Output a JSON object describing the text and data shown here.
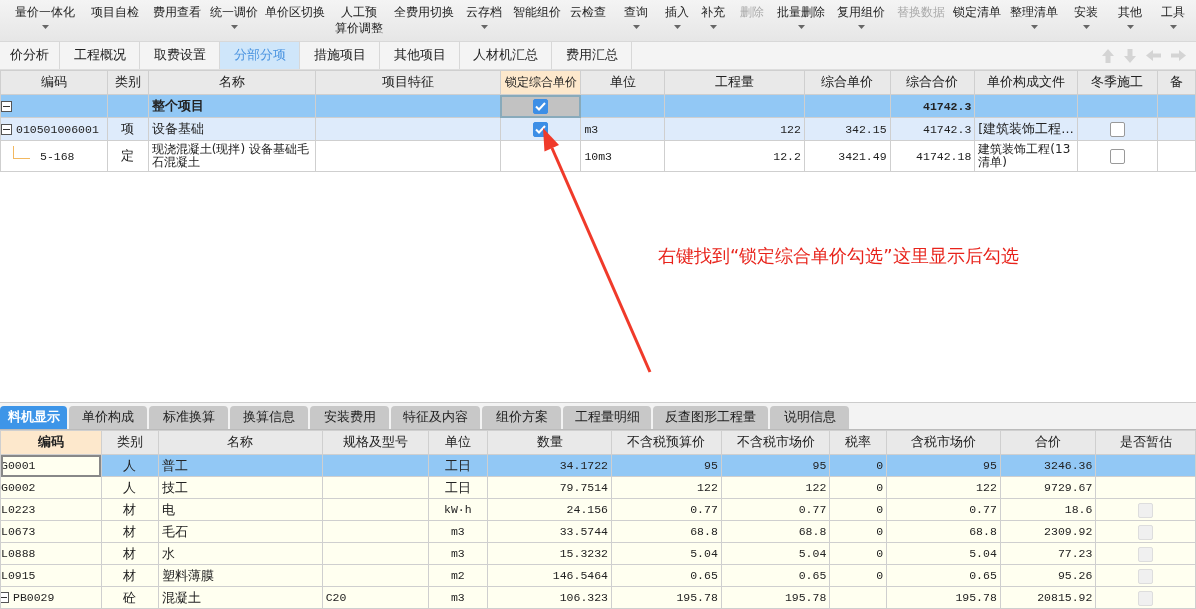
{
  "toolbar": [
    {
      "label": "量价一体化",
      "dropdown": true,
      "disabled": false
    },
    {
      "label": "项目自检",
      "dropdown": false,
      "disabled": false
    },
    {
      "label": "费用查看",
      "dropdown": false,
      "disabled": false
    },
    {
      "label": "统一调价",
      "dropdown": true,
      "disabled": false
    },
    {
      "label": "单价区切换",
      "dropdown": false,
      "disabled": false
    },
    {
      "label": "人工预",
      "label_2": "算价调整",
      "dropdown": false,
      "disabled": false
    },
    {
      "label": "全费用切换",
      "dropdown": false,
      "disabled": false
    },
    {
      "label": "云存档",
      "dropdown": true,
      "disabled": false
    },
    {
      "label": "智能组价",
      "dropdown": false,
      "disabled": false
    },
    {
      "label": "云检查",
      "dropdown": false,
      "disabled": false
    },
    {
      "label": "查询",
      "dropdown": true,
      "disabled": false
    },
    {
      "label": "插入",
      "dropdown": true,
      "disabled": false
    },
    {
      "label": "补充",
      "dropdown": true,
      "disabled": false
    },
    {
      "label": "删除",
      "dropdown": false,
      "disabled": true
    },
    {
      "label": "批量删除",
      "dropdown": true,
      "disabled": false
    },
    {
      "label": "复用组价",
      "dropdown": true,
      "disabled": false
    },
    {
      "label": "替换数据",
      "dropdown": false,
      "disabled": true
    },
    {
      "label": "锁定清单",
      "dropdown": false,
      "disabled": false
    },
    {
      "label": "整理清单",
      "dropdown": true,
      "disabled": false
    },
    {
      "label": "安装",
      "dropdown": true,
      "disabled": false
    },
    {
      "label": "其他",
      "dropdown": true,
      "disabled": false
    },
    {
      "label": "工具",
      "dropdown": true,
      "disabled": false
    }
  ],
  "tabs": [
    {
      "label": "价分析",
      "selected": false
    },
    {
      "label": "工程概况",
      "selected": false
    },
    {
      "label": "取费设置",
      "selected": false
    },
    {
      "label": "分部分项",
      "selected": true
    },
    {
      "label": "措施项目",
      "selected": false
    },
    {
      "label": "其他项目",
      "selected": false
    },
    {
      "label": "人材机汇总",
      "selected": false
    },
    {
      "label": "费用汇总",
      "selected": false
    }
  ],
  "bill_table": {
    "columns": [
      {
        "label": "编码",
        "highlighted": false
      },
      {
        "label": "类别",
        "highlighted": false
      },
      {
        "label": "名称",
        "highlighted": false
      },
      {
        "label": "项目特征",
        "highlighted": false
      },
      {
        "label": "锁定综合单价",
        "highlighted": true
      },
      {
        "label": "单位",
        "highlighted": false
      },
      {
        "label": "工程量",
        "highlighted": false
      },
      {
        "label": "综合单价",
        "highlighted": false
      },
      {
        "label": "综合合价",
        "highlighted": false
      },
      {
        "label": "单价构成文件",
        "highlighted": false
      },
      {
        "label": "冬季施工",
        "highlighted": false
      },
      {
        "label": "备",
        "highlighted": false
      }
    ],
    "rows": [
      {
        "kind": "total",
        "expanded": true,
        "selected": true,
        "code": "",
        "type": "",
        "name": "整个项目",
        "locked": true,
        "unit": "",
        "quantity": "",
        "unit_price": "",
        "total_price": "41742.3",
        "pricing_file": ""
      },
      {
        "kind": "item",
        "expanded": true,
        "selected": false,
        "code": "010501006001",
        "type": "项",
        "name": "设备基础",
        "locked": true,
        "unit": "m3",
        "quantity": "122",
        "unit_price": "342.15",
        "total_price": "41742.3",
        "pricing_file": "[建筑装饰工程…",
        "winter_construction": false
      },
      {
        "kind": "quota",
        "selected": false,
        "code": "5-168",
        "type": "定",
        "name": "现浇混凝土(现拌) 设备基础毛石混凝土",
        "unit": "10m3",
        "quantity": "12.2",
        "unit_price": "3421.49",
        "total_price": "41742.18",
        "pricing_file": "建筑装饰工程(13清单)",
        "winter_construction": false
      }
    ]
  },
  "annotation": {
    "text": "右键找到“锁定综合单价勾选”这里显示后勾选"
  },
  "detail_tabs": [
    {
      "label": "料机显示",
      "selected": true
    },
    {
      "label": "单价构成",
      "selected": false
    },
    {
      "label": "标准换算",
      "selected": false
    },
    {
      "label": "换算信息",
      "selected": false
    },
    {
      "label": "安装费用",
      "selected": false
    },
    {
      "label": "特征及内容",
      "selected": false
    },
    {
      "label": "组价方案",
      "selected": false
    },
    {
      "label": "工程量明细",
      "selected": false
    },
    {
      "label": "反查图形工程量",
      "selected": false
    },
    {
      "label": "说明信息",
      "selected": false
    }
  ],
  "resource_table": {
    "columns": [
      {
        "label": "编码",
        "highlighted": true
      },
      {
        "label": "类别",
        "highlighted": false
      },
      {
        "label": "名称",
        "highlighted": false
      },
      {
        "label": "规格及型号",
        "highlighted": false
      },
      {
        "label": "单位",
        "highlighted": false
      },
      {
        "label": "数量",
        "highlighted": false
      },
      {
        "label": "不含税预算价",
        "highlighted": false
      },
      {
        "label": "不含税市场价",
        "highlighted": false
      },
      {
        "label": "税率",
        "highlighted": false
      },
      {
        "label": "含税市场价",
        "highlighted": false
      },
      {
        "label": "合价",
        "highlighted": false
      },
      {
        "label": "是否暂估",
        "highlighted": false
      }
    ],
    "rows": [
      {
        "selected": true,
        "code": "G0001",
        "type": "人",
        "name": "普工",
        "spec": "",
        "unit": "工日",
        "quantity": "34.1722",
        "budget_price": "95",
        "market_price": "95",
        "tax_rate": "0",
        "tax_market_price": "95",
        "total": "3246.36"
      },
      {
        "selected": false,
        "code": "G0002",
        "type": "人",
        "name": "技工",
        "spec": "",
        "unit": "工日",
        "quantity": "79.7514",
        "budget_price": "122",
        "market_price": "122",
        "tax_rate": "0",
        "tax_market_price": "122",
        "total": "9729.67"
      },
      {
        "selected": false,
        "code": "L0223",
        "type": "材",
        "name": "电",
        "spec": "",
        "unit": "kW·h",
        "quantity": "24.156",
        "budget_price": "0.77",
        "market_price": "0.77",
        "tax_rate": "0",
        "tax_market_price": "0.77",
        "total": "18.6",
        "provisional": false
      },
      {
        "selected": false,
        "code": "L0673",
        "type": "材",
        "name": "毛石",
        "spec": "",
        "unit": "m3",
        "quantity": "33.5744",
        "budget_price": "68.8",
        "market_price": "68.8",
        "tax_rate": "0",
        "tax_market_price": "68.8",
        "total": "2309.92",
        "provisional": false
      },
      {
        "selected": false,
        "code": "L0888",
        "type": "材",
        "name": "水",
        "spec": "",
        "unit": "m3",
        "quantity": "15.3232",
        "budget_price": "5.04",
        "market_price": "5.04",
        "tax_rate": "0",
        "tax_market_price": "5.04",
        "total": "77.23",
        "provisional": false
      },
      {
        "selected": false,
        "code": "L0915",
        "type": "材",
        "name": "塑料薄膜",
        "spec": "",
        "unit": "m2",
        "quantity": "146.5464",
        "budget_price": "0.65",
        "market_price": "0.65",
        "tax_rate": "0",
        "tax_market_price": "0.65",
        "total": "95.26",
        "provisional": false
      },
      {
        "selected": false,
        "expanded": true,
        "code": "PB0029",
        "type": "砼",
        "name": "混凝土",
        "spec": "C20",
        "unit": "m3",
        "quantity": "106.323",
        "budget_price": "195.78",
        "market_price": "195.78",
        "tax_rate": "",
        "tax_market_price": "195.78",
        "total": "20815.92",
        "provisional": false
      }
    ]
  }
}
